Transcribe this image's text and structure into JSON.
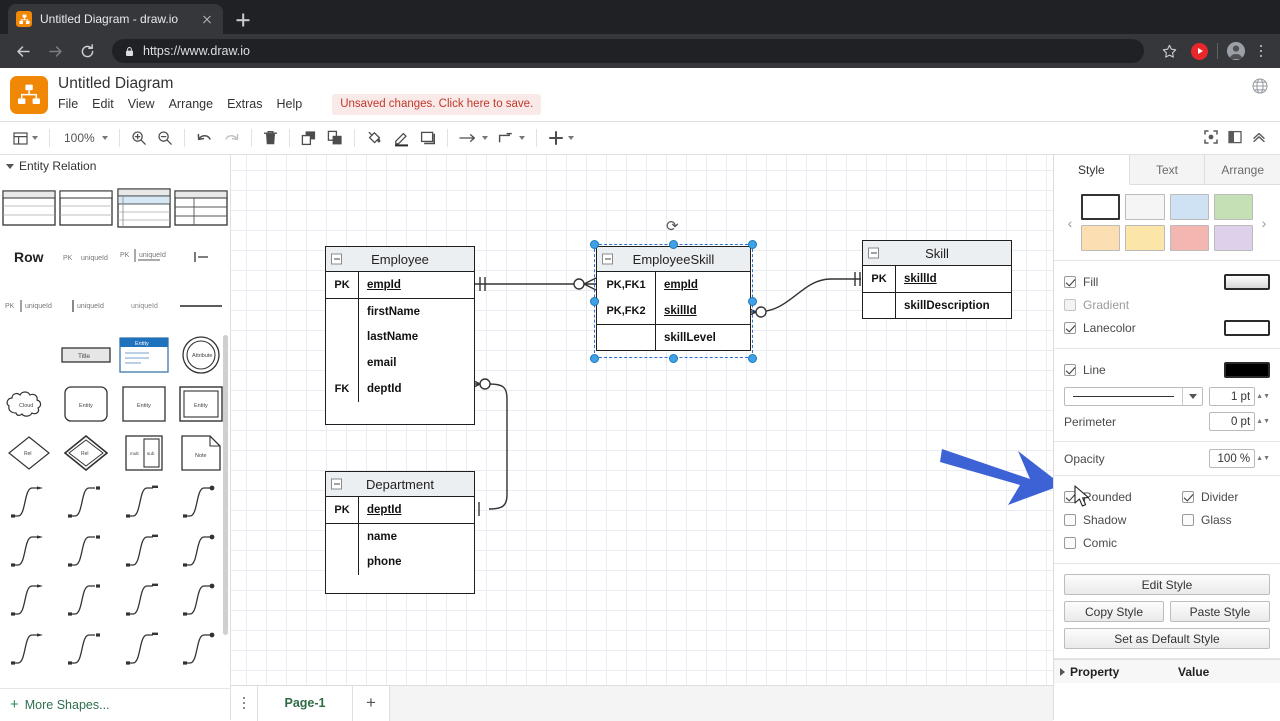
{
  "browser": {
    "tab_title": "Untitled Diagram - draw.io",
    "favicon_name": "drawio-favicon",
    "url": "https://www.draw.io",
    "new_tab_label": "+"
  },
  "header": {
    "app_title": "Untitled Diagram",
    "menus": [
      "File",
      "Edit",
      "View",
      "Arrange",
      "Extras",
      "Help"
    ],
    "unsaved_notice": "Unsaved changes. Click here to save."
  },
  "toolbar": {
    "zoom_level": "100%",
    "items": [
      "view-layers",
      "zoom-level",
      "zoom-in",
      "zoom-out",
      "undo",
      "redo",
      "delete",
      "to-front",
      "to-back",
      "fill-color",
      "line-color",
      "shadow",
      "connection",
      "waypoints",
      "insert"
    ],
    "right_items": [
      "fullscreen",
      "format-panel-toggle",
      "collapse-toolbar"
    ]
  },
  "shapes_panel": {
    "section_title": "Entity Relation",
    "row_label": "Row",
    "more_shapes_label": "More Shapes...",
    "shape_labels": [
      "Table 1",
      "Table 2",
      "Table 3",
      "Table 4",
      "Row",
      "PK uniqueId",
      "PK uniqueId",
      "I-",
      "PK uniqueId",
      "uniqueId",
      "uniqueId",
      "line",
      "Title",
      "Entity",
      "Attribute",
      "Cloud",
      "Entity",
      "Entity",
      "Entity",
      "Rel",
      "Rel",
      "Mult",
      "Note"
    ]
  },
  "canvas": {
    "tables": [
      {
        "name": "Employee",
        "rows": [
          {
            "key": "PK",
            "field": "empId",
            "pk": true,
            "divider": false
          },
          {
            "key": "",
            "field": "firstName",
            "pk": false,
            "divider": true
          },
          {
            "key": "",
            "field": "lastName",
            "pk": false,
            "divider": false
          },
          {
            "key": "",
            "field": "email",
            "pk": false,
            "divider": false
          },
          {
            "key": "FK",
            "field": "deptId",
            "pk": false,
            "divider": false
          }
        ]
      },
      {
        "name": "EmployeeSkill",
        "selected": true,
        "rows": [
          {
            "key": "PK,FK1",
            "field": "empId",
            "pk": true,
            "divider": false
          },
          {
            "key": "PK,FK2",
            "field": "skillId",
            "pk": true,
            "divider": false
          },
          {
            "key": "",
            "field": "skillLevel",
            "pk": false,
            "divider": true
          }
        ]
      },
      {
        "name": "Skill",
        "rows": [
          {
            "key": "PK",
            "field": "skillId",
            "pk": true,
            "divider": false
          },
          {
            "key": "",
            "field": "skillDescription",
            "pk": false,
            "divider": true
          }
        ]
      },
      {
        "name": "Department",
        "rows": [
          {
            "key": "PK",
            "field": "deptId",
            "pk": true,
            "divider": false
          },
          {
            "key": "",
            "field": "name",
            "pk": false,
            "divider": true
          },
          {
            "key": "",
            "field": "phone",
            "pk": false,
            "divider": false
          }
        ]
      }
    ],
    "annotation_arrow_color": "#3c62d6"
  },
  "format_panel": {
    "tabs": [
      {
        "label": "Style",
        "active": true
      },
      {
        "label": "Text",
        "active": false
      },
      {
        "label": "Arrange",
        "active": false
      }
    ],
    "swatches": [
      "#ffffff",
      "#f5f5f5",
      "#cfe2f3",
      "#c5e0b4",
      "#fbdfb2",
      "#fbe5a8",
      "#f4b6b0",
      "#dcd0ea"
    ],
    "swatch_prev": "‹",
    "swatch_next": "›",
    "fill": {
      "label": "Fill",
      "checked": true,
      "color": "#e4e4e4"
    },
    "gradient": {
      "label": "Gradient",
      "checked": false
    },
    "lanecolor": {
      "label": "Lanecolor",
      "checked": true,
      "color": "#ffffff"
    },
    "line": {
      "label": "Line",
      "checked": true,
      "color": "#000000"
    },
    "line_width": "1 pt",
    "perimeter_label": "Perimeter",
    "perimeter_value": "0 pt",
    "opacity_label": "Opacity",
    "opacity_value": "100 %",
    "toggles": [
      {
        "label": "Rounded",
        "checked": true,
        "enabled": true
      },
      {
        "label": "Divider",
        "checked": true,
        "enabled": true
      },
      {
        "label": "Shadow",
        "checked": false,
        "enabled": true
      },
      {
        "label": "Glass",
        "checked": false,
        "enabled": true
      },
      {
        "label": "Comic",
        "checked": false,
        "enabled": true
      }
    ],
    "buttons": {
      "edit_style": "Edit Style",
      "copy_style": "Copy Style",
      "paste_style": "Paste Style",
      "set_default": "Set as Default Style"
    },
    "property_header": {
      "property": "Property",
      "value": "Value"
    }
  },
  "pagebar": {
    "page_label": "Page-1",
    "add_label": "+"
  }
}
